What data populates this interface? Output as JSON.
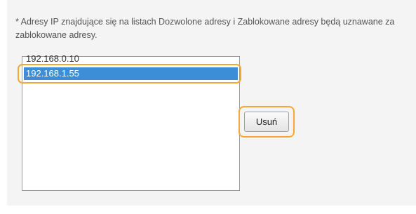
{
  "note": "* Adresy IP znajdujące się na listach Dozwolone adresy i Zablokowane adresy będą uznawane za zablokowane adresy.",
  "address_list": {
    "items": [
      "192.168.0.10",
      "192.168.1.55"
    ],
    "selected_index": 1
  },
  "remove_button_label": "Usuń",
  "colors": {
    "highlight_outline": "#f5a633",
    "selection_background": "#3c8fd6"
  }
}
